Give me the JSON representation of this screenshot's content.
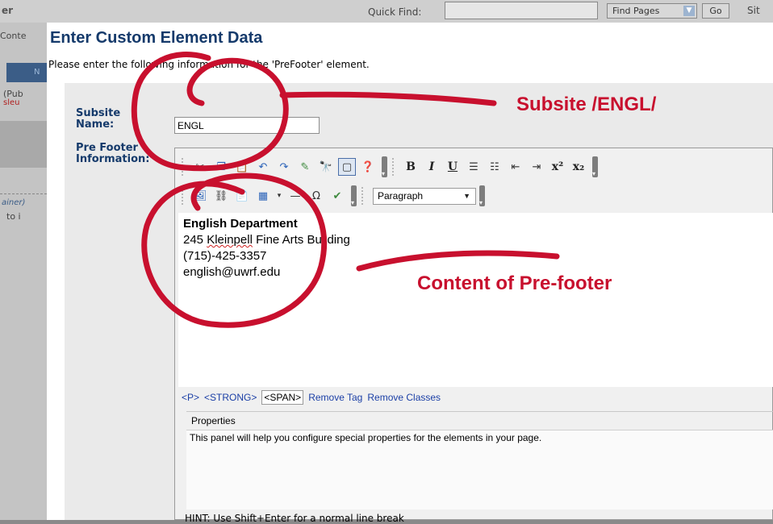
{
  "background": {
    "title": "er",
    "quick_find_label": "Quick Find:",
    "find_pages_select": "Find Pages",
    "go_button": "Go",
    "site_link": "Sit",
    "left_tab": "Conte",
    "nav_button": "N",
    "pub_text": "(Pub",
    "red_text": "sleu",
    "italic_text": "ainer)",
    "to_text": "to i"
  },
  "dialog": {
    "title": "Enter Custom Element Data",
    "subtitle": "Please enter the following information for the 'PreFooter' element.",
    "fields": {
      "subsite_label_1": "Subsite",
      "subsite_label_2": "Name:",
      "subsite_value": "ENGL",
      "prefooter_label_1": "Pre Footer",
      "prefooter_label_2": "Information:"
    }
  },
  "editor": {
    "toolbar_row1": [
      "cut-icon",
      "copy-icon",
      "paste-icon",
      "undo-icon",
      "redo-icon",
      "find-replace-icon",
      "find-icon",
      "select-all-icon",
      "help-icon",
      "bold-icon",
      "italic-icon",
      "underline-icon",
      "ordered-list-icon",
      "bullet-list-icon",
      "outdent-icon",
      "indent-icon",
      "superscript-icon",
      "subscript-icon"
    ],
    "toolbar_row2": [
      "image-icon",
      "link-icon",
      "document-icon",
      "table-icon",
      "horizontal-rule-icon",
      "special-char-icon",
      "spellcheck-icon"
    ],
    "format_select": "Paragraph",
    "content": {
      "line1": "English Department",
      "line2_pre": "245 ",
      "line2_spell": "Kleinpell",
      "line2_post": " Fine Arts Building",
      "line3": "(715)-425-3357",
      "line4": "english@uwrf.edu"
    },
    "tags": {
      "p": "<P>",
      "strong": "<STRONG>",
      "span": "<SPAN>",
      "remove_tag": "Remove Tag",
      "remove_classes": "Remove Classes"
    },
    "properties": {
      "title": "Properties",
      "text": "This panel will help you configure special properties for the elements in your page."
    },
    "hint": "HINT: Use Shift+Enter for a normal line break"
  },
  "annotations": {
    "subsite": "Subsite /ENGL/",
    "prefooter": "Content of Pre-footer",
    "color": "#c8102e"
  }
}
